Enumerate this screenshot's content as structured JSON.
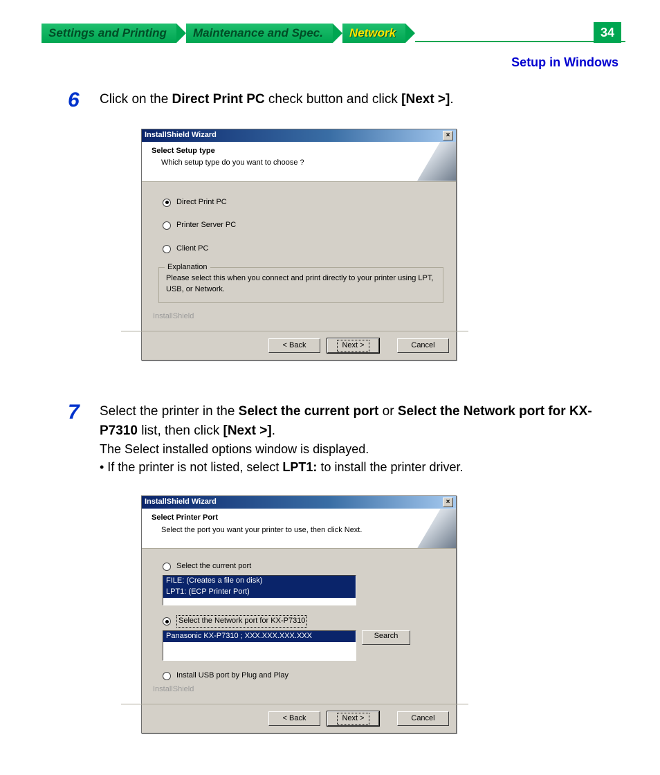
{
  "nav": {
    "tabs": [
      "Settings and Printing",
      "Maintenance and Spec.",
      "Network"
    ],
    "page": "34",
    "crumb": "Setup in Windows"
  },
  "step6": {
    "num": "6",
    "text_a": "Click on the ",
    "text_b": "Direct Print PC",
    "text_c": " check button and click ",
    "text_d": "[Next >]",
    "text_e": "."
  },
  "step7": {
    "num": "7",
    "text_a": "Select the printer in the ",
    "text_b": "Select the current port",
    "text_c": " or ",
    "text_d": "Select the Network port for KX-P7310",
    "text_e": " list, then click ",
    "text_f": "[Next >]",
    "text_g": ".",
    "note1": "The Select installed options window is displayed.",
    "note2a": "• If the printer is not listed, select ",
    "note2b": "LPT1:",
    "note2c": " to install the printer driver."
  },
  "dlg1": {
    "title": "InstallShield Wizard",
    "h1": "Select Setup type",
    "h2": "Which setup type do you want to choose ?",
    "opt1": "Direct Print PC",
    "opt2": "Printer Server PC",
    "opt3": "Client PC",
    "legend": "Explanation",
    "expl": "Please select this when you connect and print directly to your printer using LPT, USB, or Network.",
    "brand": "InstallShield",
    "back": "< Back",
    "next": "Next >",
    "cancel": "Cancel"
  },
  "dlg2": {
    "title": "InstallShield Wizard",
    "h1": "Select Printer Port",
    "h2": "Select the port you want your printer to use, then click Next.",
    "opt1": "Select the current port",
    "list1a": "FILE: (Creates a file on disk)",
    "list1b": "LPT1: (ECP Printer Port)",
    "opt2": "Select the Network port for KX-P7310",
    "list2a": "Panasonic KX-P7310 ; XXX.XXX.XXX.XXX",
    "search": "Search",
    "opt3": "Install USB port by Plug and Play",
    "brand": "InstallShield",
    "back": "< Back",
    "next": "Next >",
    "cancel": "Cancel"
  }
}
